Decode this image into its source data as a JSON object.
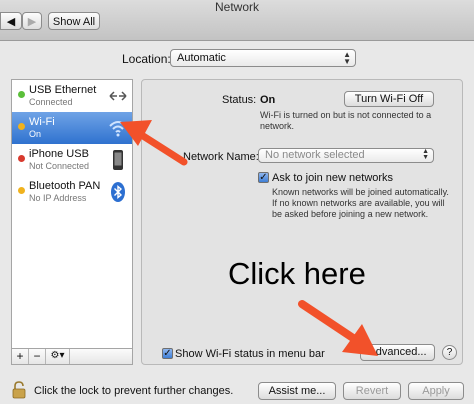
{
  "window": {
    "title": "Network",
    "back_label": "◀",
    "forward_label": "▶",
    "show_all_label": "Show All"
  },
  "location": {
    "label": "Location:",
    "value": "Automatic"
  },
  "services": [
    {
      "name": "USB Ethernet",
      "status": "Connected",
      "dot_color": "#5bbf3a",
      "icon": "ethernet-icon"
    },
    {
      "name": "Wi-Fi",
      "status": "On",
      "dot_color": "#f0b21e",
      "icon": "wifi-icon",
      "selected": true
    },
    {
      "name": "iPhone USB",
      "status": "Not Connected",
      "dot_color": "#d83a2e",
      "icon": "iphone-icon"
    },
    {
      "name": "Bluetooth PAN",
      "status": "No IP Address",
      "dot_color": "#f0b21e",
      "icon": "bluetooth-icon"
    }
  ],
  "sidebar_controls": {
    "add": "+",
    "remove": "−",
    "gear": "⚙▾"
  },
  "panel": {
    "status_label": "Status:",
    "status_value": "On",
    "turn_off_label": "Turn Wi-Fi Off",
    "status_desc_1": "Wi-Fi is turned on but is not connected to a",
    "status_desc_2": "network.",
    "network_name_label": "Network Name:",
    "network_name_placeholder": "No network selected",
    "ask_join_label": "Ask to join new networks",
    "ask_join_desc_1": "Known networks will be joined automatically.",
    "ask_join_desc_2": "If no known networks are available, you will",
    "ask_join_desc_3": "be asked before joining a new network.",
    "show_wifi_label": "Show Wi-Fi status in menu bar",
    "advanced_label": "Advanced...",
    "help_label": "?"
  },
  "overlay": {
    "click_here": "Click here",
    "arrow_color": "#f2512a"
  },
  "footer": {
    "lock_text": "Click the lock to prevent further changes.",
    "assist_label": "Assist me...",
    "revert_label": "Revert",
    "apply_label": "Apply"
  }
}
